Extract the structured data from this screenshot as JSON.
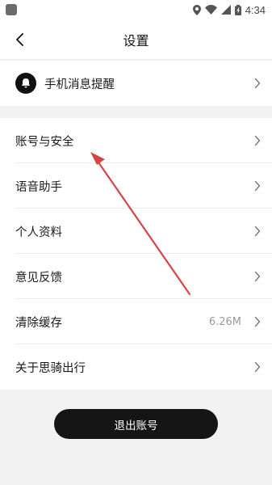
{
  "status_bar": {
    "time": "4:34"
  },
  "header": {
    "title": "设置"
  },
  "notifications": {
    "label": "手机消息提醒"
  },
  "settings_items": [
    {
      "label": "账号与安全",
      "value": ""
    },
    {
      "label": "语音助手",
      "value": ""
    },
    {
      "label": "个人资料",
      "value": ""
    },
    {
      "label": "意见反馈",
      "value": ""
    },
    {
      "label": "清除缓存",
      "value": "6.26M"
    },
    {
      "label": "关于思骑出行",
      "value": ""
    }
  ],
  "logout": {
    "label": "退出账号"
  },
  "colors": {
    "annotation_arrow": "#d64545",
    "button_bg": "#151515"
  }
}
